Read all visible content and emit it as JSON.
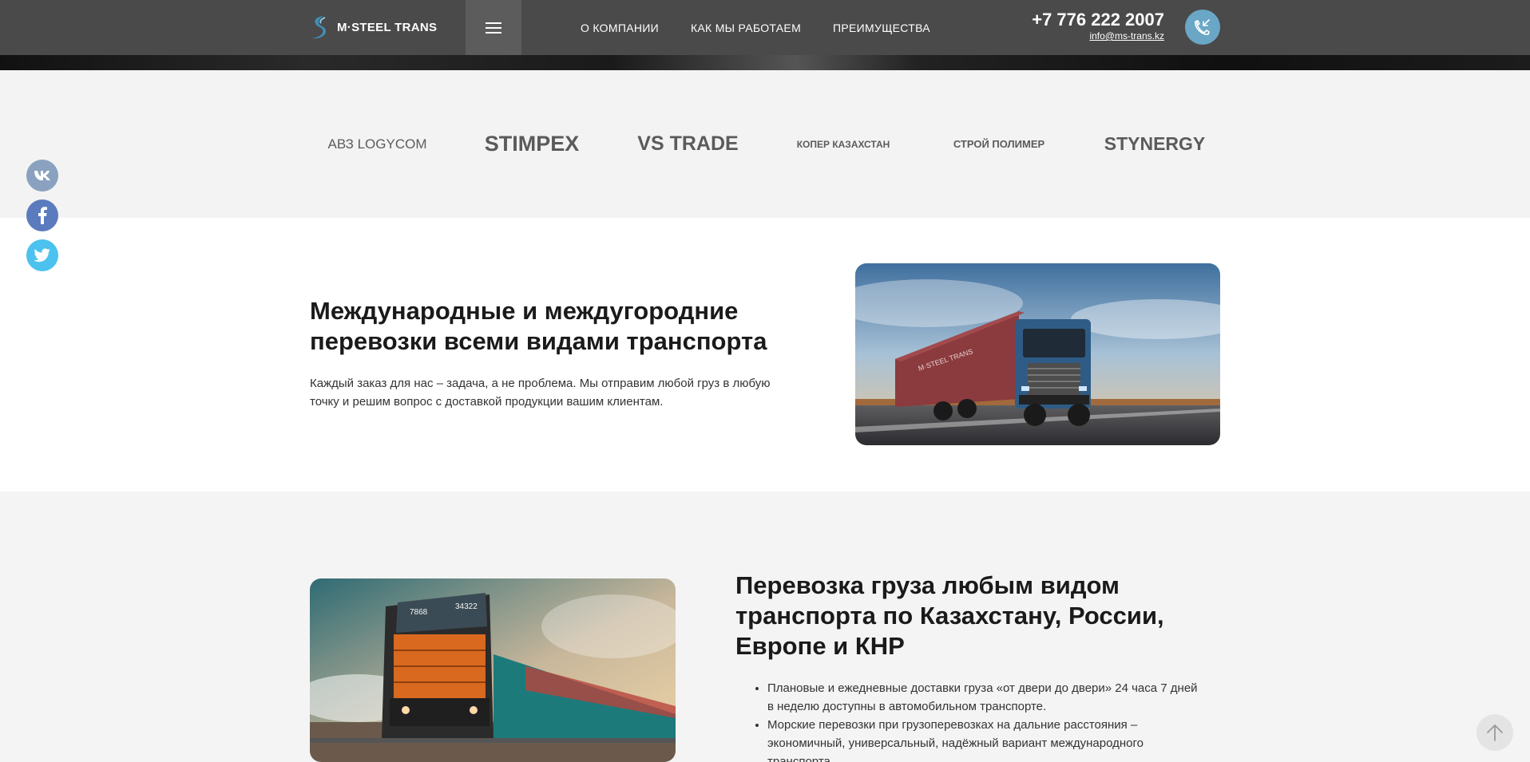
{
  "header": {
    "logo_text": "M·STEEL TRANS",
    "nav": [
      "О КОМПАНИИ",
      "КАК МЫ РАБОТАЕМ",
      "ПРЕИМУЩЕСТВА"
    ],
    "phone": "+7 776 222 2007",
    "email": "info@ms-trans.kz",
    "bg_color": "#4a4a4a",
    "accent_color": "#6aa7c6",
    "menu_icon": "hamburger-icon",
    "call_icon": "phone-callback-icon"
  },
  "partners": {
    "items": [
      "АВЗ LOGYCOM",
      "STIMPEX",
      "VS TRADE",
      "КОПЕР КАЗАХСТАН",
      "СТРОЙ ПОЛИМЕР",
      "STYNERGY"
    ]
  },
  "social": {
    "vk_icon": "vk-icon",
    "facebook_icon": "facebook-icon",
    "twitter_icon": "twitter-icon",
    "vk_color": "#8aa2c0",
    "facebook_color": "#5b7bbf",
    "twitter_color": "#4cc2ee"
  },
  "section1": {
    "title": "Международные и междугородние перевозки всеми видами транспорта",
    "text": "Каждый заказ для нас – задача, а не проблема. Мы отправим любой груз в любую точку и решим вопрос с доставкой продукции вашим клиентам.",
    "image": "truck-image",
    "truck_label": "M·STEEL TRANS"
  },
  "section2": {
    "title": "Перевозка груза любым видом транспорта по Казахстану, России, Европе и КНР",
    "bullets": [
      "Плановые и ежедневные доставки груза «от двери до двери» 24 часа 7 дней в неделю доступны в автомобильном транспорте.",
      "Морские перевозки при грузоперевозках на дальние расстояния – экономичный, универсальный, надёжный вариант международного транспорта."
    ],
    "image": "train-image",
    "loco_numbers": [
      "7868",
      "34322"
    ]
  },
  "scroll_top_icon": "arrow-up-icon"
}
